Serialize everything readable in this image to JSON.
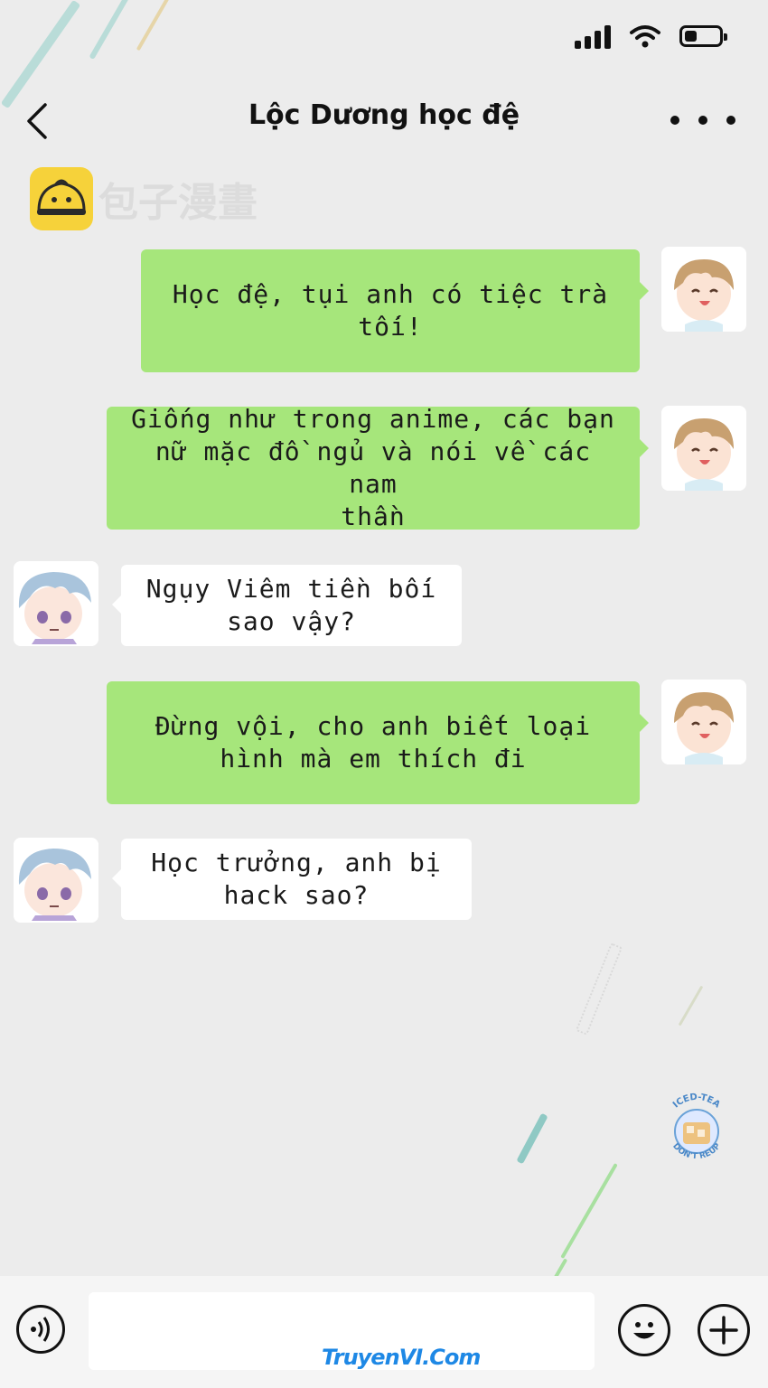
{
  "header": {
    "title": "Lộc Dương học đệ",
    "back_icon": "chevron-left-icon",
    "more_icon": "more-dots-icon"
  },
  "status_bar": {
    "signal_icon": "cellular-signal-icon",
    "wifi_icon": "wifi-icon",
    "battery_icon": "battery-icon",
    "battery_level": 0.35
  },
  "watermark": {
    "text": "包子漫畫"
  },
  "messages": [
    {
      "side": "right",
      "sender": "boy-brown-hair",
      "text": "Học đệ, tụi anh có tiệc trà tối!"
    },
    {
      "side": "right",
      "sender": "boy-brown-hair",
      "text": "Giống như trong anime, các bạn\nnữ mặc đồ ngủ và nói về các nam\nthần"
    },
    {
      "side": "left",
      "sender": "boy-blue-hair",
      "text": "Ngụy Viêm tiền bối\nsao vậy?"
    },
    {
      "side": "right",
      "sender": "boy-brown-hair",
      "text": "Đừng vội, cho anh biết loại\nhình mà em thích đi"
    },
    {
      "side": "left",
      "sender": "boy-blue-hair",
      "text": "Học trưởng, anh bị\nhack sao?"
    }
  ],
  "logo": {
    "top": "ICED-TEA",
    "bottom": "DON'T REUP"
  },
  "input_bar": {
    "voice_icon": "voice-icon",
    "emoji_icon": "emoji-icon",
    "add_icon": "plus-icon",
    "site_logo": "TruyenVI.Com"
  },
  "colors": {
    "sent_bubble": "#a6e67b",
    "received_bubble": "#ffffff",
    "background": "#ececec"
  }
}
